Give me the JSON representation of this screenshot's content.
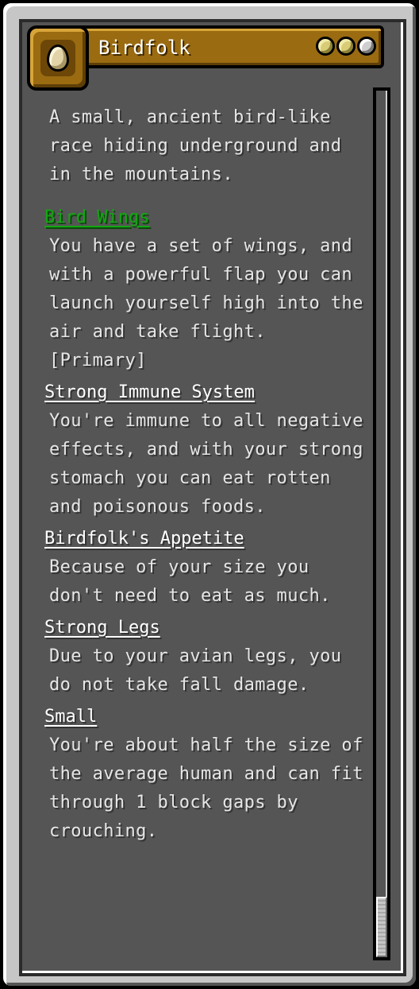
{
  "origin": {
    "name": "Birdfolk",
    "icon": "egg-icon",
    "impact_dots": 3,
    "impact_dots_filled": 2,
    "description": "A small, ancient bird-like race hiding underground and in the mountains."
  },
  "powers": [
    {
      "name": "Bird Wings",
      "primary": true,
      "description": "You have a set of wings, and with a powerful flap you can launch yourself high into the air and take flight. [Primary]"
    },
    {
      "name": "Strong Immune System",
      "primary": false,
      "description": "You're immune to all negative effects, and with your strong stomach you can eat rotten and poisonous foods."
    },
    {
      "name": "Birdfolk's Appetite",
      "primary": false,
      "description": "Because of your size you don't need to eat as much."
    },
    {
      "name": "Strong Legs",
      "primary": false,
      "description": "Due to your avian legs, you do not take fall damage."
    },
    {
      "name": "Small",
      "primary": false,
      "description": "You're about half the size of the average human and can fit through 1 block gaps by crouching."
    }
  ],
  "colors": {
    "panel": "#555555",
    "header": "#9a6b10",
    "primary_power": "#13a613",
    "text": "#e6e6e6"
  },
  "scroll": {
    "position": 1.0
  }
}
